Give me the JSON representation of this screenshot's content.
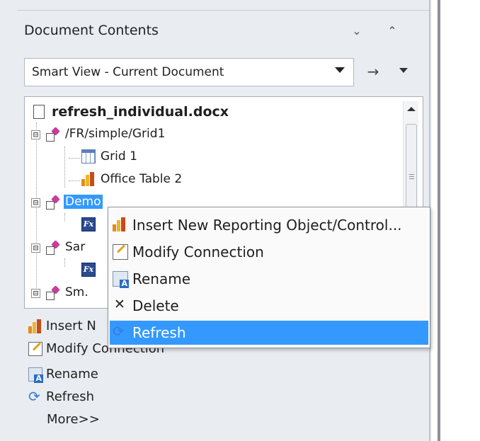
{
  "panel": {
    "title": "Document Contents",
    "collapse_icon": "chevron-down-icon",
    "expand_all_icon": "double-chevron-up-icon"
  },
  "view_selector": {
    "value": "Smart View - Current Document",
    "go_icon": "arrow-right-icon",
    "menu_icon": "triangle-down-icon"
  },
  "tree": {
    "root": "refresh_individual.docx",
    "nodes": [
      {
        "label": "/FR/simple/Grid1",
        "type": "connection",
        "expander": "⊟"
      },
      {
        "label": "Grid 1",
        "type": "grid"
      },
      {
        "label": "Office Table 2",
        "type": "table"
      },
      {
        "label": "Demo",
        "type": "connection",
        "expander": "⊟",
        "selected": true
      },
      {
        "label": "Sar",
        "type": "connection",
        "expander": "⊟"
      },
      {
        "label": "Sm.",
        "type": "connection",
        "expander": "⊟"
      }
    ]
  },
  "context_menu": {
    "items": [
      {
        "label": "Insert New Reporting Object/Control...",
        "icon": "bar-chart-icon"
      },
      {
        "label": "Modify Connection",
        "icon": "edit-connection-icon"
      },
      {
        "label": "Rename",
        "icon": "rename-icon"
      },
      {
        "label": "Delete",
        "icon": "delete-icon"
      },
      {
        "label": "Refresh",
        "icon": "refresh-icon",
        "highlighted": true
      }
    ]
  },
  "actions": {
    "items": [
      {
        "label": "Insert N",
        "icon": "bar-chart-icon"
      },
      {
        "label": "Modify Connection",
        "icon": "edit-connection-icon"
      },
      {
        "label": "Rename",
        "icon": "rename-icon"
      },
      {
        "label": "Refresh",
        "icon": "refresh-icon"
      },
      {
        "label": "More>>",
        "icon": ""
      }
    ]
  },
  "colors": {
    "selection": "#3399ff",
    "panel_bg": "#e9ecf1"
  }
}
